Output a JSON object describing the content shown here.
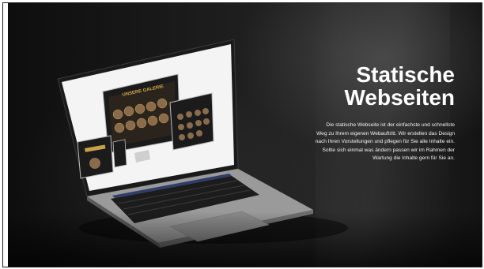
{
  "hero": {
    "title_line1": "Statische",
    "title_line2": "Webseiten",
    "description_lines": [
      "Die statische Webseite ist der einfachste und schnellste",
      "Weg zu Ihrem eigenen Webauftritt. Wir erstellen das Design",
      "nach Ihren Vorstellungen und pflegen für Sie alle Inhalte ein.",
      "Sollte sich einmal was ändern passen wir im Rahmen der",
      "Wartung die Inhalte gern für Sie an."
    ]
  },
  "mockup": {
    "gallery_heading": "UNSERE GALERIE",
    "device_name": "laptop"
  },
  "colors": {
    "background": "#1d1d1d",
    "text": "#ffffff",
    "accent_gold": "#c8a24a"
  }
}
